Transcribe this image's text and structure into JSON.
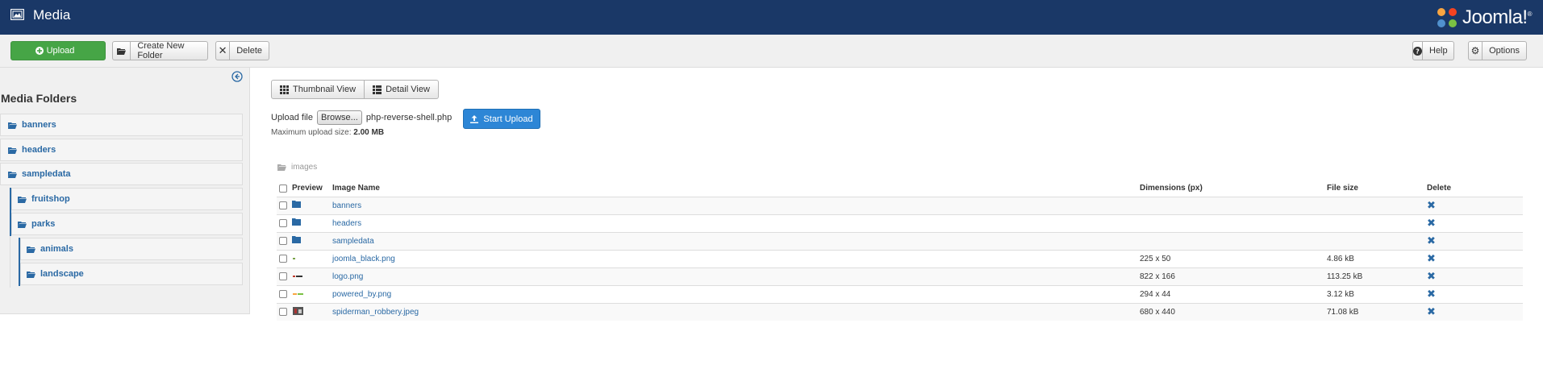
{
  "header": {
    "title": "Media",
    "logo_text": "Joomla!",
    "logo_mark": "®"
  },
  "toolbar": {
    "upload_label": "Upload",
    "new_folder_label": "Create New Folder",
    "delete_label": "Delete",
    "help_label": "Help",
    "options_label": "Options"
  },
  "sidebar": {
    "heading": "Media Folders",
    "folders": [
      {
        "label": "banners"
      },
      {
        "label": "headers"
      },
      {
        "label": "sampledata"
      },
      {
        "label": "fruitshop"
      },
      {
        "label": "parks"
      },
      {
        "label": "animals"
      },
      {
        "label": "landscape"
      }
    ]
  },
  "views": {
    "thumbnail": "Thumbnail View",
    "detail": "Detail View"
  },
  "upload": {
    "label": "Upload file",
    "browse_label": "Browse...",
    "file_name": "php-reverse-shell.php",
    "start_label": "Start Upload",
    "max_label": "Maximum upload size:",
    "max_value": "2.00 MB"
  },
  "breadcrumb": "images",
  "table": {
    "headers": {
      "preview": "Preview",
      "name": "Image Name",
      "dimensions": "Dimensions (px)",
      "size": "File size",
      "delete": "Delete"
    },
    "rows": [
      {
        "name": "banners",
        "kind": "folder",
        "dimensions": "",
        "size": ""
      },
      {
        "name": "headers",
        "kind": "folder",
        "dimensions": "",
        "size": ""
      },
      {
        "name": "sampledata",
        "kind": "folder",
        "dimensions": "",
        "size": ""
      },
      {
        "name": "joomla_black.png",
        "kind": "image",
        "dimensions": "225 x 50",
        "size": "4.86 kB"
      },
      {
        "name": "logo.png",
        "kind": "image",
        "dimensions": "822 x 166",
        "size": "113.25 kB"
      },
      {
        "name": "powered_by.png",
        "kind": "image",
        "dimensions": "294 x 44",
        "size": "3.12 kB"
      },
      {
        "name": "spiderman_robbery.jpeg",
        "kind": "image",
        "dimensions": "680 x 440",
        "size": "71.08 kB"
      }
    ]
  },
  "colors": {
    "header_bg": "#1a3867",
    "link": "#2a69a4",
    "upload_green": "#46a546",
    "start_blue": "#2d86d6"
  }
}
